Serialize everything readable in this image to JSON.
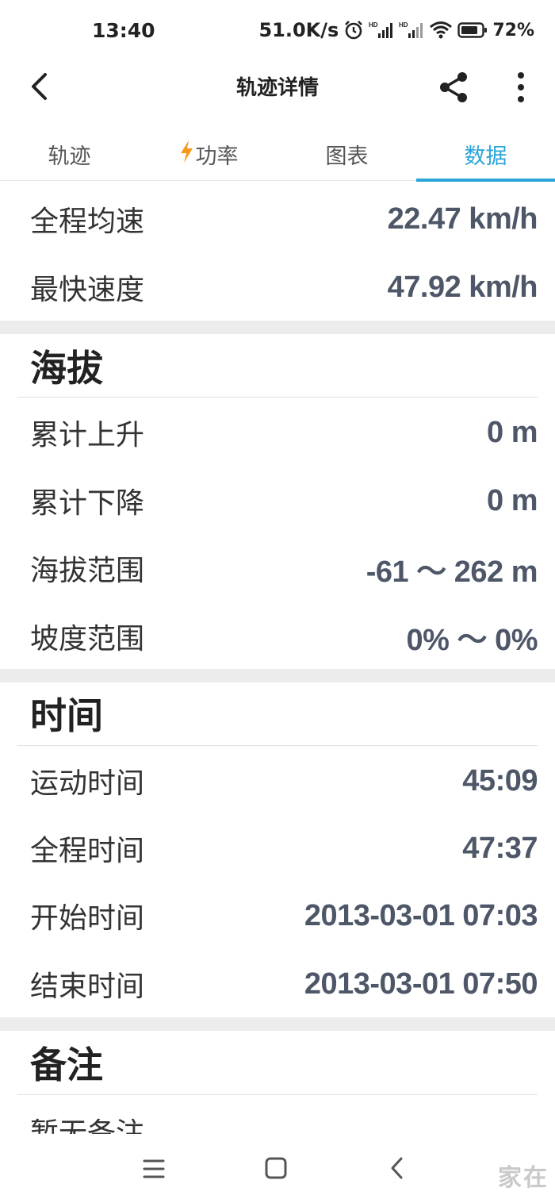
{
  "status_bar": {
    "time": "13:40",
    "net_speed": "51.0K/s",
    "battery": "72%"
  },
  "app_bar": {
    "title": "轨迹详情",
    "back_icon": "back-arrow-icon",
    "share_icon": "share-icon",
    "more_icon": "more-vertical-icon"
  },
  "tabs": [
    {
      "label": "轨迹",
      "active": false
    },
    {
      "label": "功率",
      "active": false,
      "icon": "bolt-icon",
      "badge": "red-dot"
    },
    {
      "label": "图表",
      "active": false
    },
    {
      "label": "数据",
      "active": true
    }
  ],
  "colors": {
    "accent": "#2aa5d8",
    "value_text": "#4e5768",
    "badge": "#e8121e",
    "bolt": "#f39a1e"
  },
  "speed": {
    "rows": [
      {
        "label": "全程均速",
        "value": "22.47 km/h"
      },
      {
        "label": "最快速度",
        "value": "47.92 km/h"
      }
    ]
  },
  "altitude": {
    "title": "海拔",
    "rows": [
      {
        "label": "累计上升",
        "value": "0 m"
      },
      {
        "label": "累计下降",
        "value": "0 m"
      },
      {
        "label": "海拔范围",
        "value": "-61 ～ 262 m"
      },
      {
        "label": "坡度范围",
        "value": "0% ～ 0%"
      }
    ]
  },
  "time": {
    "title": "时间",
    "rows": [
      {
        "label": "运动时间",
        "value": "45:09"
      },
      {
        "label": "全程时间",
        "value": "47:37"
      },
      {
        "label": "开始时间",
        "value": "2013-03-01 07:03"
      },
      {
        "label": "结束时间",
        "value": "2013-03-01 07:50"
      }
    ]
  },
  "notes": {
    "title": "备注",
    "text": "暂无备注"
  },
  "nav_bar": {
    "menu_icon": "menu-icon",
    "home_icon": "home-square-icon",
    "back_icon": "nav-back-icon",
    "watermark": "家在"
  }
}
